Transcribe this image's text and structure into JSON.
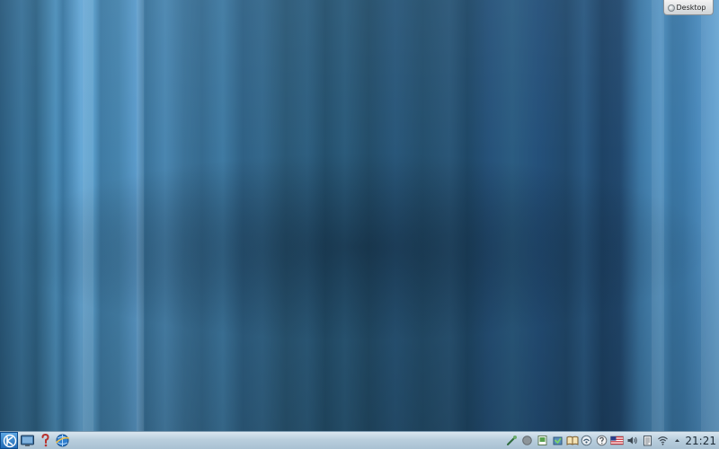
{
  "toolbox": {
    "label": "Desktop"
  },
  "panel": {
    "clock_time": "21:21",
    "launcher_icon": "kde-menu-icon",
    "quick_launch": [
      "show-desktop-icon",
      "help-icon",
      "web-browser-icon"
    ],
    "tray": [
      "klipper-icon",
      "status-dot-icon",
      "notes-icon",
      "package-updates-icon",
      "dictionary-icon",
      "network-manager-icon",
      "help-center-icon",
      "keyboard-layout-us-flag-icon",
      "volume-icon",
      "clipboard-icon",
      "wifi-icon",
      "tray-expand-arrow-icon"
    ]
  },
  "colors": {
    "panel_bg": "#b9cedd",
    "launcher_bg": "#1e68b4",
    "desktop_bg": "#2f6385"
  }
}
